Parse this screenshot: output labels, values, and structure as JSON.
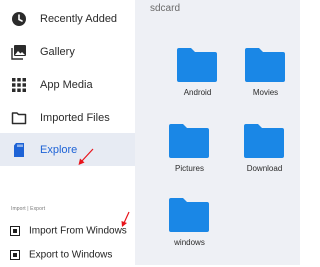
{
  "sidebar": {
    "items": [
      {
        "label": "Recently Added",
        "icon": "clock-icon"
      },
      {
        "label": "Gallery",
        "icon": "image-gallery-icon"
      },
      {
        "label": "App Media",
        "icon": "grid-dots-icon"
      },
      {
        "label": "Imported Files",
        "icon": "folder-outline-icon"
      },
      {
        "label": "Explore",
        "icon": "sd-card-icon",
        "active": true
      }
    ],
    "section_label": "Import | Export",
    "actions": [
      {
        "label": "Import From Windows",
        "icon": "import-icon"
      },
      {
        "label": "Export to Windows",
        "icon": "export-icon"
      }
    ]
  },
  "content": {
    "path": "sdcard",
    "folders": [
      {
        "name": "Android"
      },
      {
        "name": "Movies"
      },
      {
        "name": "Pictures"
      },
      {
        "name": "Download"
      },
      {
        "name": "windows"
      }
    ]
  },
  "colors": {
    "folder": "#1a87e6",
    "active_bg": "#e7ebf3",
    "active_text": "#1e63d6",
    "annotation_arrow": "#e8141b",
    "content_bg": "#eef0f5"
  }
}
